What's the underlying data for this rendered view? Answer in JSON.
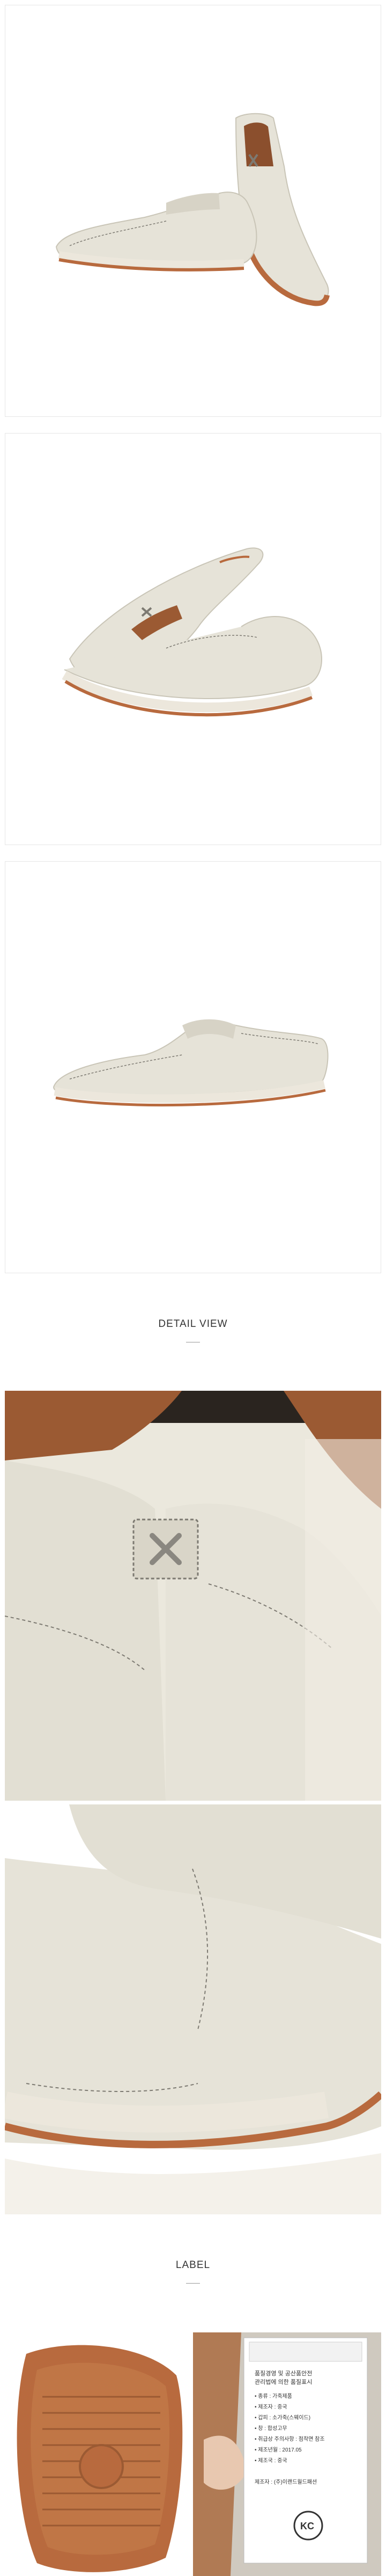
{
  "sections": {
    "detail_view_title": "DETAIL VIEW",
    "label_title": "LABEL"
  },
  "colors": {
    "leather": "#e6e3d8",
    "leather_shadow": "#c9c5b7",
    "sole_white": "#ece7dc",
    "outsole_brown": "#b86a3e",
    "lining_brown": "#9b5a33",
    "stitch": "#7d7a72",
    "background_dark": "#2a241f"
  },
  "label": {
    "lines": [
      "품질경영 및 공산품안전",
      "관리법에 의한 품질표시",
      "• 종류 : 가죽제품",
      "• 제조자 : 중국",
      "• 갑피 : 소가죽(스웨이드)",
      "• 창 : 합성고무",
      "• 취급상 주의사항 : 점착면 참조",
      "• 제조년월 : 2017.05",
      "• 제조국 : 중국",
      "제조자 : (주)이랜드월드패션"
    ],
    "mark": "KC"
  }
}
